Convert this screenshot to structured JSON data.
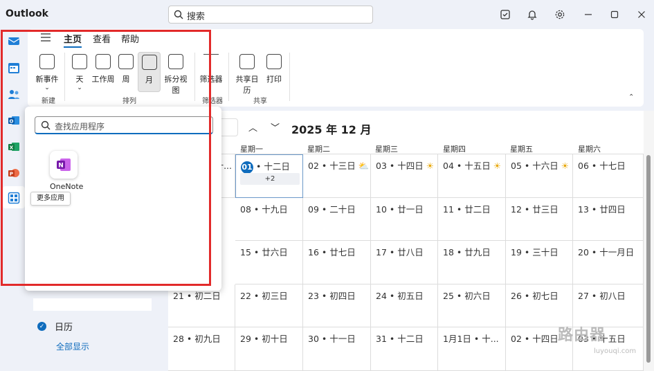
{
  "titlebar": {
    "app_title": "Outlook",
    "search_placeholder": "搜索",
    "icons": [
      "task-check-icon",
      "bell-icon",
      "gear-icon",
      "minimize-icon",
      "maximize-icon",
      "close-icon"
    ]
  },
  "rail": {
    "icons": [
      "mail-icon",
      "calendar-icon",
      "people-icon",
      "outlook-icon",
      "excel-icon",
      "powerpoint-icon",
      "more-apps-icon"
    ]
  },
  "ribbon": {
    "tabs": [
      {
        "label": "主页",
        "active": true
      },
      {
        "label": "查看",
        "active": false
      },
      {
        "label": "帮助",
        "active": false
      }
    ],
    "buttons": {
      "new_event": "新事件",
      "day": "天",
      "work_week": "工作周",
      "week": "周",
      "month": "月",
      "split_view": "拆分视图",
      "filter": "筛选器",
      "share_calendar": "共享日历",
      "print": "打印"
    },
    "groups": {
      "new": "新建",
      "arrange": "排列",
      "filter": "筛选器",
      "share": "共享"
    }
  },
  "calendar": {
    "month_label": "2025 年 12 月",
    "day_names": [
      "星期一",
      "星期二",
      "星期三",
      "星期四",
      "星期五",
      "星期六"
    ],
    "weeks": [
      [
        "01 • 十二日",
        "02 • 十三日",
        "03 • 十四日",
        "04 • 十五日",
        "05 • 十六日",
        "06 • 十七日"
      ],
      [
        "08 • 十九日",
        "09 • 二十日",
        "10 • 廿一日",
        "11 • 廿二日",
        "12 • 廿三日",
        "13 • 廿四日"
      ],
      [
        "15 • 廿六日",
        "16 • 廿七日",
        "17 • 廿八日",
        "18 • 廿九日",
        "19 • 三十日",
        "20 • 十一月日"
      ],
      [
        "22 • 初三日",
        "23 • 初四日",
        "24 • 初五日",
        "25 • 初六日",
        "26 • 初七日",
        "27 • 初八日"
      ],
      [
        "29 • 初十日",
        "30 • 十一日",
        "31 • 十二日",
        "1月1日 • 十...",
        "02 • 十四日",
        "03 • 十五日"
      ]
    ],
    "left_partial": [
      "十...",
      "21 • 初二日",
      "28 • 初九日"
    ],
    "today_extra": "+2",
    "today_num": "01",
    "today_rest": " • 十二日"
  },
  "sidepanel": {
    "calendar_name": "日历",
    "show_all": "全部显示"
  },
  "popup": {
    "search_placeholder": "查找应用程序",
    "app_name": "OneNote",
    "tooltip": "更多应用"
  },
  "watermark": {
    "text": "路由器",
    "sub": "luyouqi.com"
  },
  "colors": {
    "accent": "#0f6cbd",
    "highlight": "#e22a2a",
    "onenote": "#7719aa"
  }
}
